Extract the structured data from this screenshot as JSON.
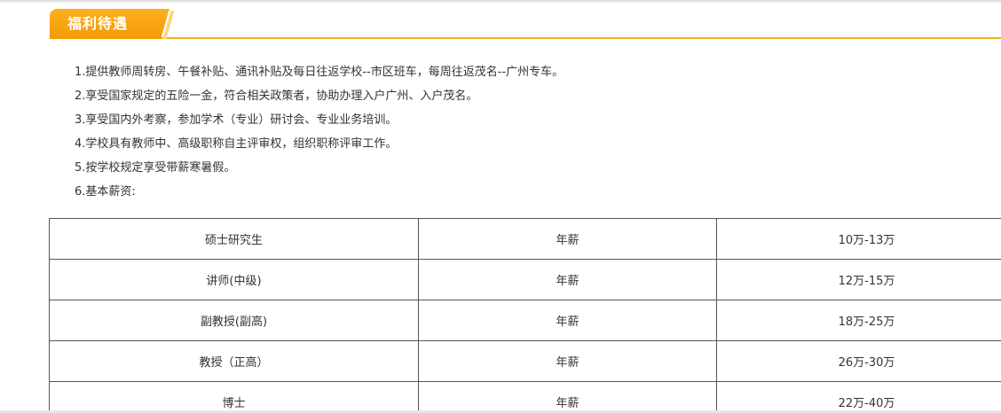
{
  "section": {
    "title": "福利待遇"
  },
  "benefits": [
    "1.提供教师周转房、午餐补贴、通讯补贴及每日往返学校--市区班车，每周往返茂名--广州专车。",
    "2.享受国家规定的五险一金，符合相关政策者，协助办理入户广州、入户茂名。",
    "3.享受国内外考察，参加学术（专业）研讨会、专业业务培训。",
    "4.学校具有教师中、高级职称自主评审权，组织职称评审工作。",
    "5.按学校规定享受带薪寒暑假。",
    "6.基本薪资:"
  ],
  "salary_table": {
    "rows": [
      {
        "title": "硕士研究生",
        "type": "年薪",
        "range": "10万-13万"
      },
      {
        "title": "讲师(中级)",
        "type": "年薪",
        "range": "12万-15万"
      },
      {
        "title": "副教授(副高)",
        "type": "年薪",
        "range": "18万-25万"
      },
      {
        "title": "教授（正高）",
        "type": "年薪",
        "range": "26万-30万"
      },
      {
        "title": "博士",
        "type": "年薪",
        "range": "22万-40万"
      }
    ]
  },
  "colors": {
    "accent": "#f29a05",
    "header_line": "#f1b31c",
    "text": "#333333",
    "table_border": "#555555"
  }
}
